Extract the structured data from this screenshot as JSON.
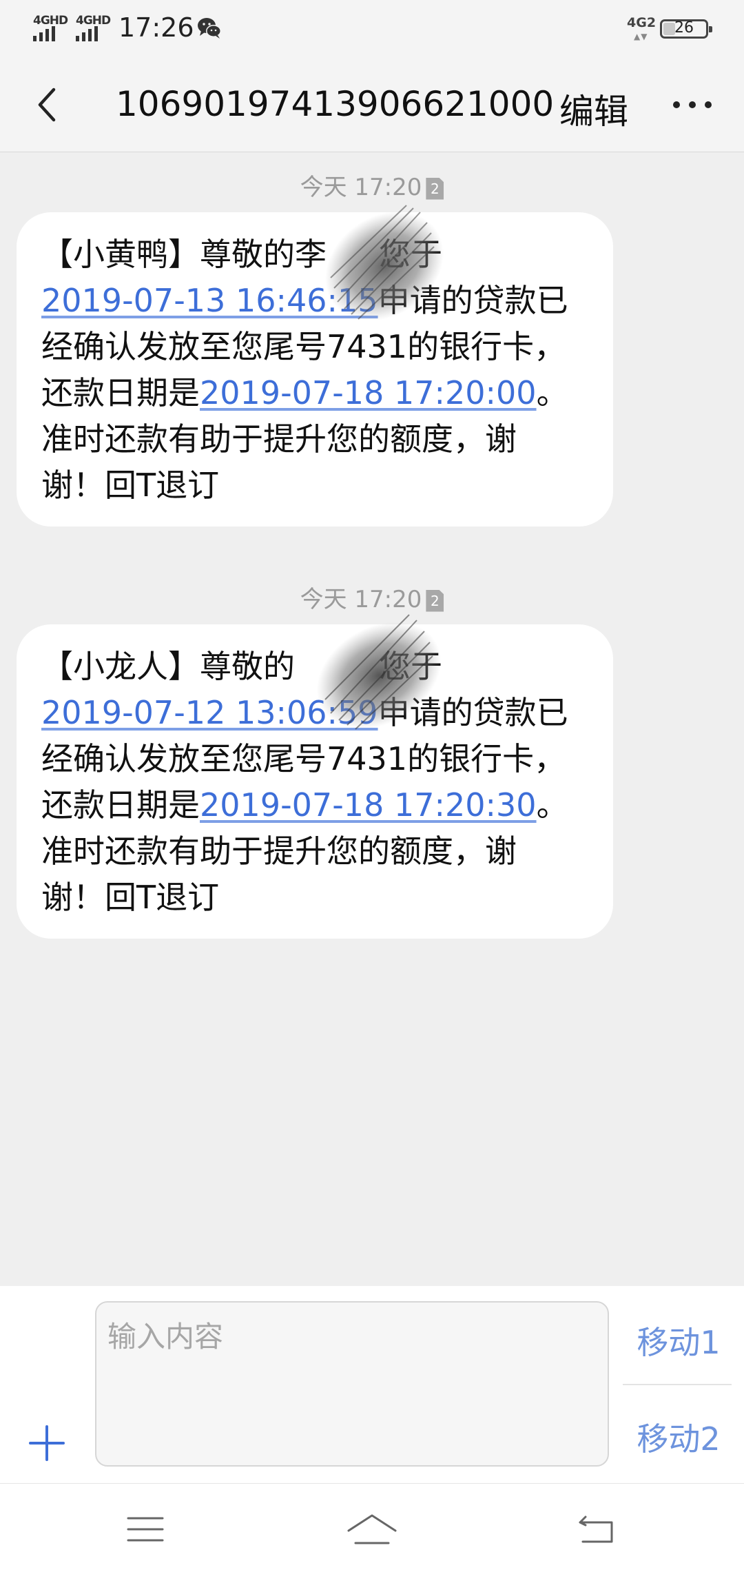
{
  "status_bar": {
    "sim1_network": "4GHD",
    "sim2_network": "4GHD",
    "time": "17:26",
    "right_network": "4G2",
    "battery_percent": "26",
    "battery_level": 0.26,
    "notification_icon": "wechat-icon"
  },
  "header": {
    "back_icon": "chevron-left-icon",
    "title": "1069019741390662100​0",
    "edit_label": "编辑",
    "more_icon": "more-dots-icon"
  },
  "messages": [
    {
      "timestamp": "今天 17:20",
      "sim": "2",
      "line1": "【小黄鸭】尊敬的李",
      "line1_end": "您于",
      "line2_link": "2019-07-13 16:46:15",
      "line2_end": "申请的贷款已",
      "line3": "经确认发放至您尾号7431的银行卡，",
      "line4_start": "还款日期是",
      "line4_link": "2019-07-18 17:20:00",
      "line4_end": "。",
      "line5": "准时还款有助于提升您的额度，谢",
      "line6": "谢！回T退订"
    },
    {
      "timestamp": "今天 17:20",
      "sim": "2",
      "line1": "【小龙人】尊敬的",
      "line1_end": "您于",
      "line2_link": "2019-07-12 13:06:59",
      "line2_end": "申请的贷款已",
      "line3": "经确认发放至您尾号7431的银行卡，",
      "line4_start": "还款日期是",
      "line4_link": "2019-07-18 17:20:30",
      "line4_end": "。",
      "line5": "准时还款有助于提升您的额度，谢",
      "line6": "谢！回T退订"
    }
  ],
  "input": {
    "placeholder": "输入内容",
    "send1_label": "移动1",
    "send2_label": "移动2",
    "add_icon": "plus-icon"
  },
  "nav_bar": {
    "menu_icon": "menu-icon",
    "home_icon": "home-icon",
    "back_icon": "back-icon"
  },
  "colors": {
    "link": "#3d6ed8",
    "send_button": "#6d93dd",
    "background": "#efefef",
    "bubble": "#ffffff"
  }
}
